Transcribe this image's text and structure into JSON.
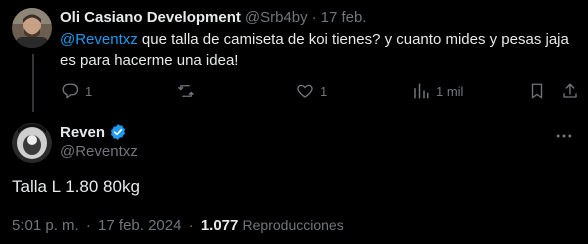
{
  "reply": {
    "author_name": "Oli Casiano Development",
    "author_handle": "@Srb4by",
    "separator": "·",
    "date": "17 feb.",
    "mention": "@Reventxz",
    "text": " que talla de camiseta de koi tienes? y cuanto mides y pesas jaja es para hacerme una idea!",
    "actions": {
      "reply_count": "1",
      "retweet_count": "",
      "like_count": "1",
      "views_count": "1 mil"
    }
  },
  "tweet": {
    "author_name": "Reven",
    "author_handle": "@Reventxz",
    "verified": true,
    "text": "Talla L 1.80 80kg",
    "time": "5:01 p. m.",
    "dot": "·",
    "date": "17 feb. 2024",
    "views_count": "1.077",
    "views_label": "Reproducciones"
  },
  "colors": {
    "background": "#000000",
    "text": "#e7e9ea",
    "muted": "#71767b",
    "accent": "#1d9bf0",
    "thread_line": "#333639"
  },
  "icons": [
    "reply-icon",
    "retweet-icon",
    "like-icon",
    "views-icon",
    "bookmark-icon",
    "share-icon",
    "verified-badge-icon",
    "more-icon"
  ]
}
